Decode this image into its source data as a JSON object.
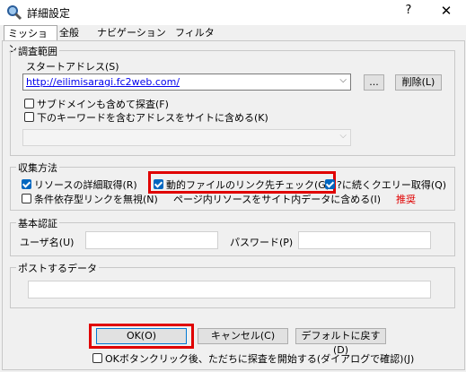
{
  "window": {
    "title": "詳細設定",
    "help": "?",
    "close": "✕"
  },
  "tabs": [
    {
      "label": "ミッション"
    },
    {
      "label": "全般"
    },
    {
      "label": "ナビゲーション"
    },
    {
      "label": "フィルタ"
    }
  ],
  "survey": {
    "legend": "調査範囲",
    "start_address_label": "スタートアドレス(S)",
    "start_url": "http://eilimisaragi.fc2web.com/",
    "browse_button": "...",
    "delete_button": "削除(L)",
    "subdomain_checkbox": "サブドメインも含めて探査(F)",
    "keyword_checkbox": "下のキーワードを含むアドレスをサイトに含める(K)",
    "keyword_value": ""
  },
  "collection": {
    "legend": "収集方法",
    "resource_detail": "リソースの詳細取得(R)",
    "dynamic_link_check": "動的ファイルのリンク先チェック(G)",
    "query_after": "?に続くクエリー取得(Q)",
    "ignore_conditional": "条件依存型リンクを無視(N)",
    "page_internal": "ページ内リソースをサイト内データに含める(I)",
    "recommend": "推奨"
  },
  "auth": {
    "legend": "基本認証",
    "user_label": "ユーザ名(U)",
    "user_value": "",
    "password_label": "パスワード(P)",
    "password_value": ""
  },
  "post": {
    "legend": "ポストするデータ",
    "value": ""
  },
  "footer": {
    "ok": "OK(O)",
    "cancel": "キャンセル(C)",
    "reset": "デフォルトに戻す(D)",
    "start_on_ok": "OKボタンクリック後、ただちに探査を開始する(ダイアログで確認)(J)"
  },
  "colors": {
    "highlight": "#e00000",
    "accent": "#0067c0",
    "link_text": "#0000ee",
    "recommend": "#e00000"
  }
}
